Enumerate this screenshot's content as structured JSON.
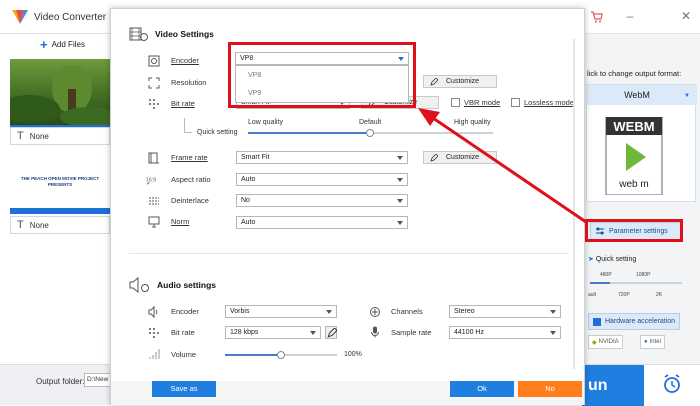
{
  "app": {
    "title": "Video Converter",
    "add_files": "Add Files",
    "output_folder_label": "Output folder:",
    "output_folder_value": "D:\\New f",
    "run_label": "un",
    "subtitle_values": [
      "None",
      "None"
    ],
    "preview_text": "THE PEACH OPEN MOVIE PROJECT PRESENTS"
  },
  "right_pane": {
    "click_change": "lick to change output format:",
    "format_name": "WebM",
    "webm_top": "WEBM",
    "webm_bottom": "web m",
    "parameter_settings": "Parameter settings",
    "quick_setting": "Quick setting",
    "mini_labels": [
      "480P",
      "1080P",
      "ault",
      "720P",
      "2K"
    ],
    "hardware_acceleration": "Hardware acceleration",
    "nvidia": "NVIDIA",
    "intel": "Intel"
  },
  "video": {
    "section_title": "Video Settings",
    "encoder": {
      "label": "Encoder",
      "value": "VP8",
      "options": [
        "VP8",
        "VP9"
      ]
    },
    "resolution": {
      "label": "Resolution",
      "customize": "Customize"
    },
    "bitrate": {
      "label": "Bit rate",
      "value": "Smart Fit",
      "customize": "Customize",
      "vbr": "VBR mode",
      "lossless": "Lossless mode"
    },
    "quick_setting": {
      "label": "Quick setting",
      "low": "Low quality",
      "default": "Default",
      "high": "High quality",
      "level": 0.5
    },
    "frame_rate": {
      "label": "Frame rate",
      "value": "Smart Fit",
      "customize": "Customize"
    },
    "aspect_ratio": {
      "label": "Aspect ratio",
      "value": "Auto"
    },
    "deinterlace": {
      "label": "Deinterlace",
      "value": "No"
    },
    "norm": {
      "label": "Norm",
      "value": "Auto"
    }
  },
  "audio": {
    "section_title": "Audio settings",
    "encoder": {
      "label": "Encoder",
      "value": "Vorbis"
    },
    "channels": {
      "label": "Channels",
      "value": "Stereo"
    },
    "bitrate": {
      "label": "Bit rate",
      "value": "128 kbps"
    },
    "sample_rate": {
      "label": "Sample rate",
      "value": "44100 Hz"
    },
    "volume": {
      "label": "Volume",
      "value": "100%",
      "level": 0.5
    }
  },
  "footer": {
    "save_as": "Save as",
    "ok": "Ok",
    "no": "No"
  },
  "colors": {
    "accent": "#1e7fe0",
    "annotation": "#e0101a",
    "cancel": "#ff7d1a"
  }
}
